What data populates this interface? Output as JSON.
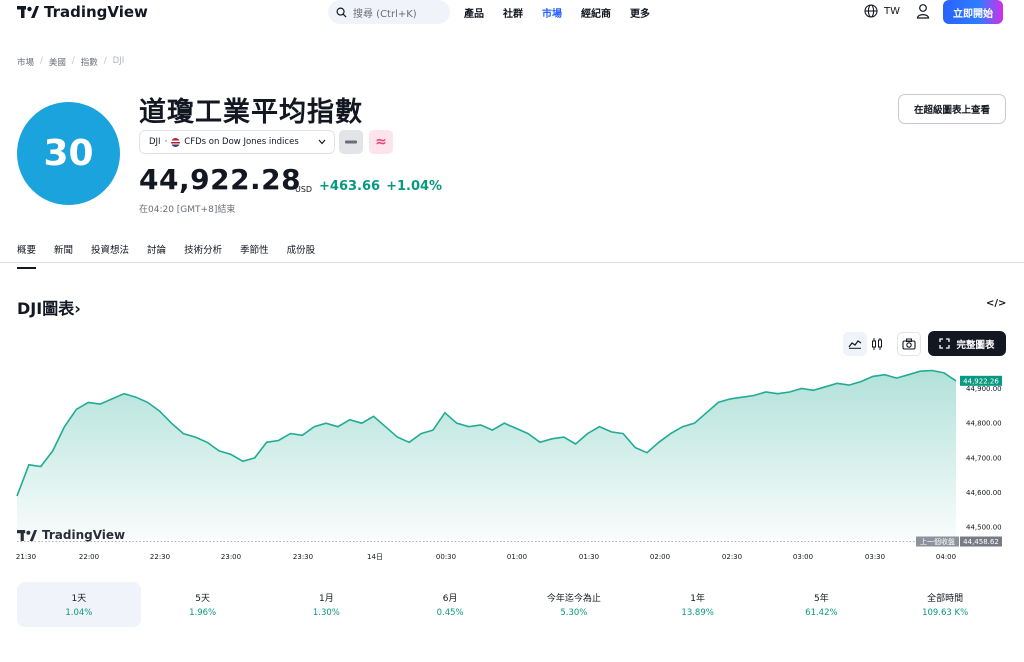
{
  "header": {
    "brand": "TradingView",
    "search_placeholder": "搜尋 (Ctrl+K)",
    "nav": [
      "產品",
      "社群",
      "市場",
      "經紀商",
      "更多"
    ],
    "nav_active_index": 2,
    "lang": "TW",
    "start_button": "立即開始"
  },
  "breadcrumb": [
    "市場",
    "美國",
    "指數",
    "DJI"
  ],
  "symbol": {
    "badge": "30",
    "title": "道瓊工業平均指數",
    "ticker": "DJI",
    "dot": "·",
    "exchange": "CFDs on Dow Jones indices",
    "pink_icon": "≈",
    "price": "44,922.28",
    "currency": "USD",
    "change_abs": "+463.66",
    "change_pct": "+1.04%",
    "closed_at": "在04:20 [GMT+8]結束",
    "supercharts_button": "在超級圖表上查看"
  },
  "tabs": [
    "概要",
    "新聞",
    "投資想法",
    "討論",
    "技術分析",
    "季節性",
    "成份股"
  ],
  "tabs_active_index": 0,
  "chart_section": {
    "title": "DJI圖表",
    "title_chevron": "›",
    "embed_glyph": "</>",
    "fullchart_button": "完整圖表",
    "watermark": "TradingView"
  },
  "colors": {
    "accent_blue": "#2962ff",
    "positive_green": "#089981",
    "line_green": "#22ab94",
    "badge_blue": "#1aa3dc"
  },
  "chart_data": {
    "type": "area",
    "x_tick_labels": [
      "21:30",
      "22:00",
      "22:30",
      "23:00",
      "23:30",
      "14日",
      "00:30",
      "01:00",
      "01:30",
      "02:00",
      "02:30",
      "03:00",
      "03:30",
      "04:00"
    ],
    "y_tick_labels": [
      "44,900.00",
      "44,800.00",
      "44,700.00",
      "44,600.00",
      "44,500.00"
    ],
    "y_ticks": [
      44900,
      44800,
      44700,
      44600,
      44500
    ],
    "ylim": [
      44463,
      44965
    ],
    "last_price_label": "44,922.26",
    "last_price": 44922.26,
    "prev_close_caption": "上一個收盤",
    "prev_close_label": "44,458.62",
    "prev_close": 44458.62,
    "values": [
      44590,
      44680,
      44675,
      44720,
      44790,
      44840,
      44860,
      44855,
      44870,
      44885,
      44875,
      44860,
      44835,
      44800,
      44770,
      44760,
      44745,
      44720,
      44710,
      44690,
      44700,
      44745,
      44750,
      44770,
      44765,
      44790,
      44800,
      44790,
      44810,
      44800,
      44820,
      44790,
      44760,
      44745,
      44770,
      44780,
      44830,
      44800,
      44790,
      44795,
      44780,
      44800,
      44785,
      44770,
      44745,
      44755,
      44760,
      44740,
      44770,
      44790,
      44775,
      44770,
      44730,
      44715,
      44745,
      44770,
      44790,
      44800,
      44830,
      44860,
      44870,
      44875,
      44880,
      44890,
      44885,
      44890,
      44900,
      44895,
      44905,
      44915,
      44910,
      44920,
      44935,
      44940,
      44930,
      44940,
      44950,
      44952,
      44945,
      44922
    ]
  },
  "periods": [
    {
      "label": "1天",
      "value": "1.04%"
    },
    {
      "label": "5天",
      "value": "1.96%"
    },
    {
      "label": "1月",
      "value": "1.30%"
    },
    {
      "label": "6月",
      "value": "0.45%"
    },
    {
      "label": "今年迄今為止",
      "value": "5.30%"
    },
    {
      "label": "1年",
      "value": "13.89%"
    },
    {
      "label": "5年",
      "value": "61.42%"
    },
    {
      "label": "全部時間",
      "value": "109.63 K%"
    }
  ],
  "periods_active_index": 0
}
